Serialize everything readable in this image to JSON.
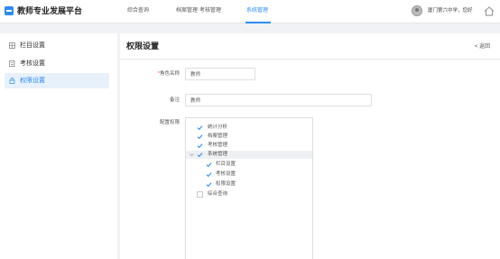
{
  "app": {
    "title": "教师专业发展平台"
  },
  "nav": [
    "综合查询",
    "档案管理",
    "考核管理",
    "系统管理"
  ],
  "user": {
    "org_text": "厦门第六中学，您好"
  },
  "sidebar": {
    "items": [
      {
        "label": "栏目设置",
        "icon": "grid-icon"
      },
      {
        "label": "考核设置",
        "icon": "edit-icon"
      },
      {
        "label": "权限设置",
        "icon": "lock-icon"
      }
    ]
  },
  "page": {
    "title": "权限设置",
    "back": "< 返回"
  },
  "form": {
    "role_label": "角色名称",
    "role_required": "*",
    "role_value": "教师",
    "note_label": "备注",
    "note_value": "教师",
    "perm_label": "配置权限"
  },
  "tree": [
    {
      "label": "统计分析",
      "checked": true,
      "level": 0
    },
    {
      "label": "档案管理",
      "checked": true,
      "level": 0
    },
    {
      "label": "考核管理",
      "checked": true,
      "level": 0
    },
    {
      "label": "系统管理",
      "checked": true,
      "level": 0,
      "expanded": true
    },
    {
      "label": "栏目设置",
      "checked": true,
      "level": 1
    },
    {
      "label": "考核设置",
      "checked": true,
      "level": 1
    },
    {
      "label": "权限设置",
      "checked": true,
      "level": 1
    },
    {
      "label": "综合查询",
      "checked": false,
      "level": 0
    }
  ],
  "colors": {
    "accent": "#2d8cf0",
    "active_bg": "#e8f1fb"
  }
}
